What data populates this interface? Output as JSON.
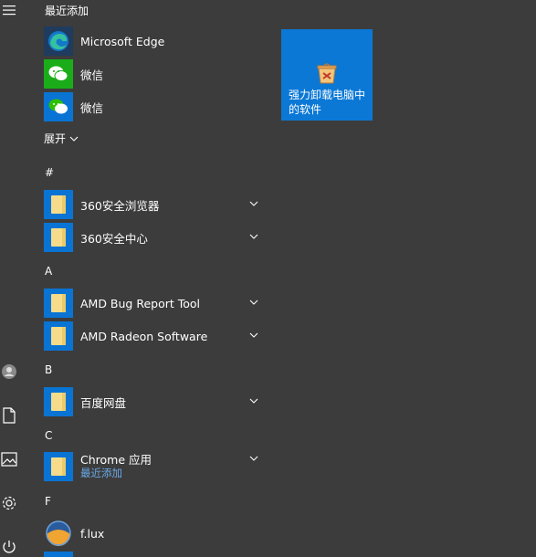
{
  "left_rail": {
    "items": [
      {
        "name": "menu-icon"
      },
      {
        "name": "user-icon"
      },
      {
        "name": "documents-icon"
      },
      {
        "name": "pictures-icon"
      },
      {
        "name": "settings-icon"
      },
      {
        "name": "power-icon"
      }
    ]
  },
  "recent": {
    "header": "最近添加",
    "apps": [
      {
        "label": "Microsoft Edge",
        "icon": "edge-icon"
      },
      {
        "label": "微信",
        "icon": "wechat-icon"
      },
      {
        "label": "微信",
        "icon": "wechat-icon"
      }
    ],
    "expand_label": "展开"
  },
  "groups": [
    {
      "letter": "#",
      "apps": [
        {
          "label": "360安全浏览器",
          "icon": "folder-icon",
          "expandable": true
        },
        {
          "label": "360安全中心",
          "icon": "folder-icon",
          "expandable": true
        }
      ]
    },
    {
      "letter": "A",
      "apps": [
        {
          "label": "AMD Bug Report Tool",
          "icon": "folder-icon",
          "expandable": true
        },
        {
          "label": "AMD Radeon Software",
          "icon": "folder-icon",
          "expandable": true
        }
      ]
    },
    {
      "letter": "B",
      "apps": [
        {
          "label": "百度网盘",
          "icon": "folder-icon",
          "expandable": true
        }
      ]
    },
    {
      "letter": "C",
      "apps": [
        {
          "label": "Chrome 应用",
          "sublabel": "最近添加",
          "icon": "folder-icon",
          "expandable": true
        }
      ]
    },
    {
      "letter": "F",
      "apps": [
        {
          "label": "f.lux",
          "icon": "flux-icon"
        }
      ]
    }
  ],
  "pinned_tile": {
    "label": "强力卸载电脑中的软件",
    "icon": "uninstall-box-icon",
    "color": "#0b78d6"
  },
  "colors": {
    "background": "#3c3c3c",
    "accent": "#0b78d6",
    "sublabel": "#6aa9e6"
  }
}
